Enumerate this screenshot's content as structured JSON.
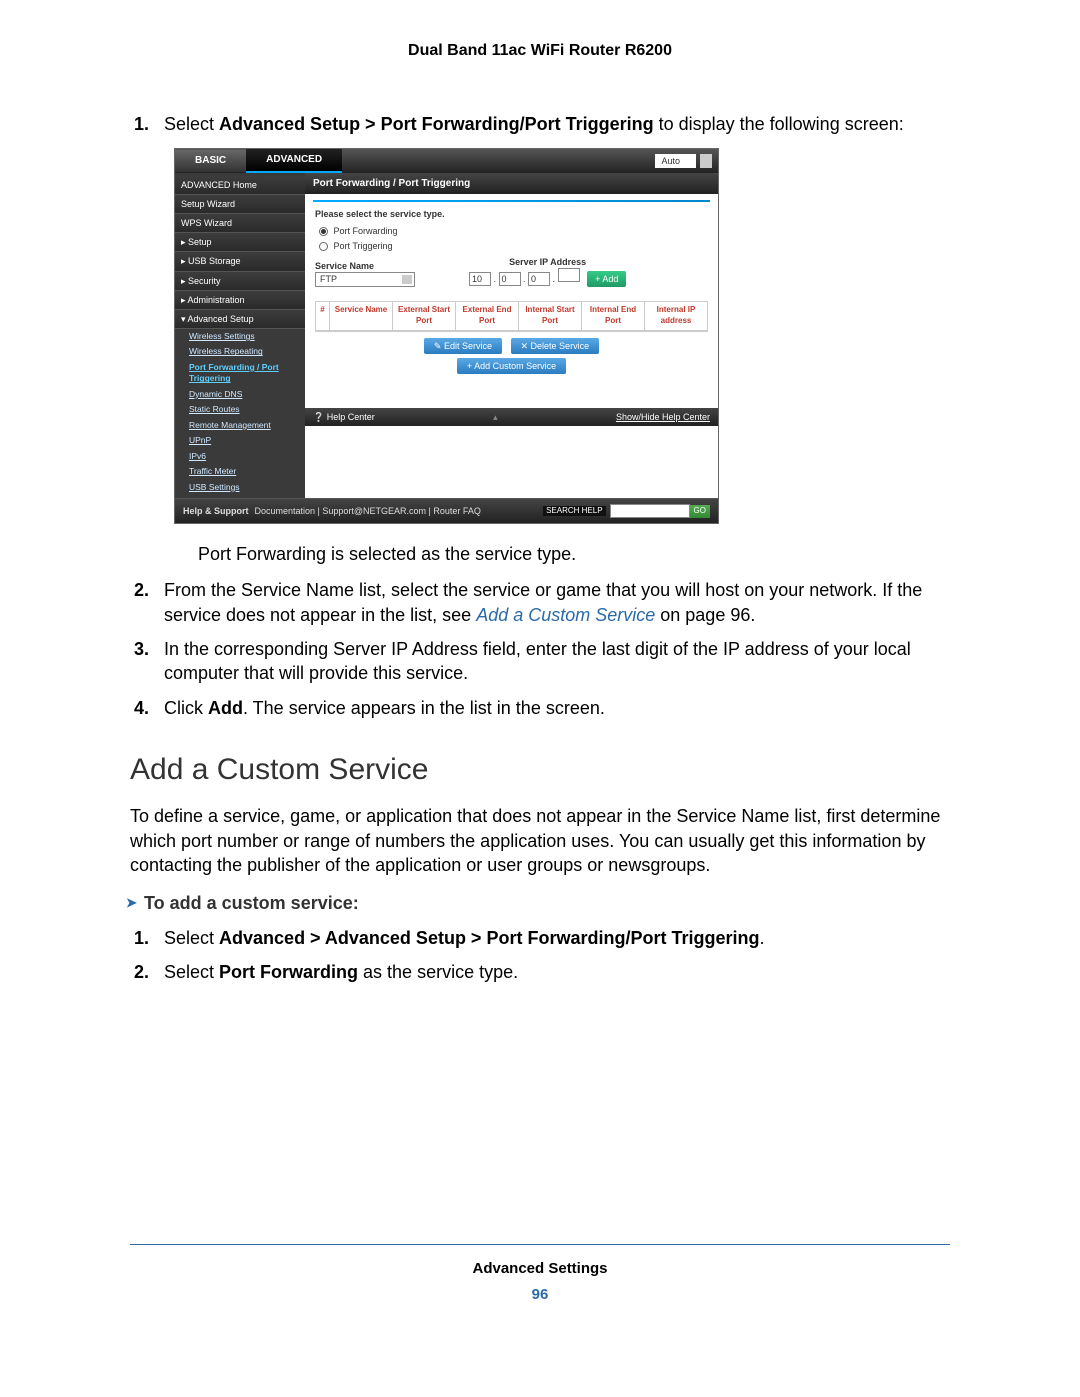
{
  "header": {
    "title": "Dual Band 11ac WiFi Router R6200"
  },
  "steps1": [
    {
      "prefix": "Select ",
      "bold": "Advanced Setup > Port Forwarding/Port Triggering",
      "suffix": " to display the following screen:"
    }
  ],
  "after_screenshot": "Port Forwarding is selected as the service type.",
  "steps1b": [
    {
      "prefix": "From the Service Name list, select the service or game that you will host on your network. If the service does not appear in the list, see ",
      "link": "Add a Custom Service",
      "suffix": " on page 96."
    },
    {
      "prefix": "In the corresponding Server IP Address field, enter the last digit of the IP address of your local computer that will provide this service."
    },
    {
      "prefix": "Click ",
      "bold": "Add",
      "suffix": ". The service appears in the list in the screen."
    }
  ],
  "section2": {
    "heading": "Add a Custom Service",
    "para": "To define a service, game, or application that does not appear in the Service Name list, first determine which port number or range of numbers the application uses. You can usually get this information by contacting the publisher of the application or user groups or newsgroups.",
    "proc_head": "To add a custom service:",
    "steps": [
      {
        "prefix": "Select ",
        "bold": "Advanced > Advanced Setup > Port Forwarding/Port Triggering",
        "suffix": "."
      },
      {
        "prefix": "Select ",
        "bold": "Port Forwarding",
        "suffix": " as the service type."
      }
    ]
  },
  "footer": {
    "label": "Advanced Settings",
    "page": "96"
  },
  "screenshot": {
    "tabs": {
      "basic": "BASIC",
      "advanced": "ADVANCED",
      "auto": "Auto"
    },
    "sidebar": {
      "items": [
        "ADVANCED Home",
        "Setup Wizard",
        "WPS Wizard",
        "▸ Setup",
        "▸ USB Storage",
        "▸ Security",
        "▸ Administration",
        "▾ Advanced Setup"
      ],
      "subs": [
        "Wireless Settings",
        "Wireless Repeating",
        "Port Forwarding / Port Triggering",
        "Dynamic DNS",
        "Static Routes",
        "Remote Management",
        "UPnP",
        "IPv6",
        "Traffic Meter",
        "USB Settings"
      ],
      "active_sub_index": 2
    },
    "main": {
      "title": "Port Forwarding / Port Triggering",
      "select_label": "Please select the service type.",
      "radio": {
        "forwarding": "Port Forwarding",
        "triggering": "Port Triggering"
      },
      "service_name_label": "Service Name",
      "service_name_value": "FTP",
      "server_ip_label": "Server IP Address",
      "ip": [
        "10",
        "0",
        "0",
        ""
      ],
      "add_btn": "+ Add",
      "table_headers": [
        "#",
        "Service Name",
        "External Start Port",
        "External End Port",
        "Internal Start Port",
        "Internal End Port",
        "Internal IP address"
      ],
      "edit_btn": "✎ Edit Service",
      "delete_btn": "✕ Delete Service",
      "custom_btn": "+ Add Custom Service",
      "help_left": "❔ Help Center",
      "help_mid": "▴",
      "help_right": "Show/Hide Help Center"
    },
    "footer": {
      "help_support": "Help & Support",
      "links": "Documentation  |  Support@NETGEAR.com  |  Router FAQ",
      "search_label": "SEARCH HELP",
      "go": "GO"
    }
  }
}
